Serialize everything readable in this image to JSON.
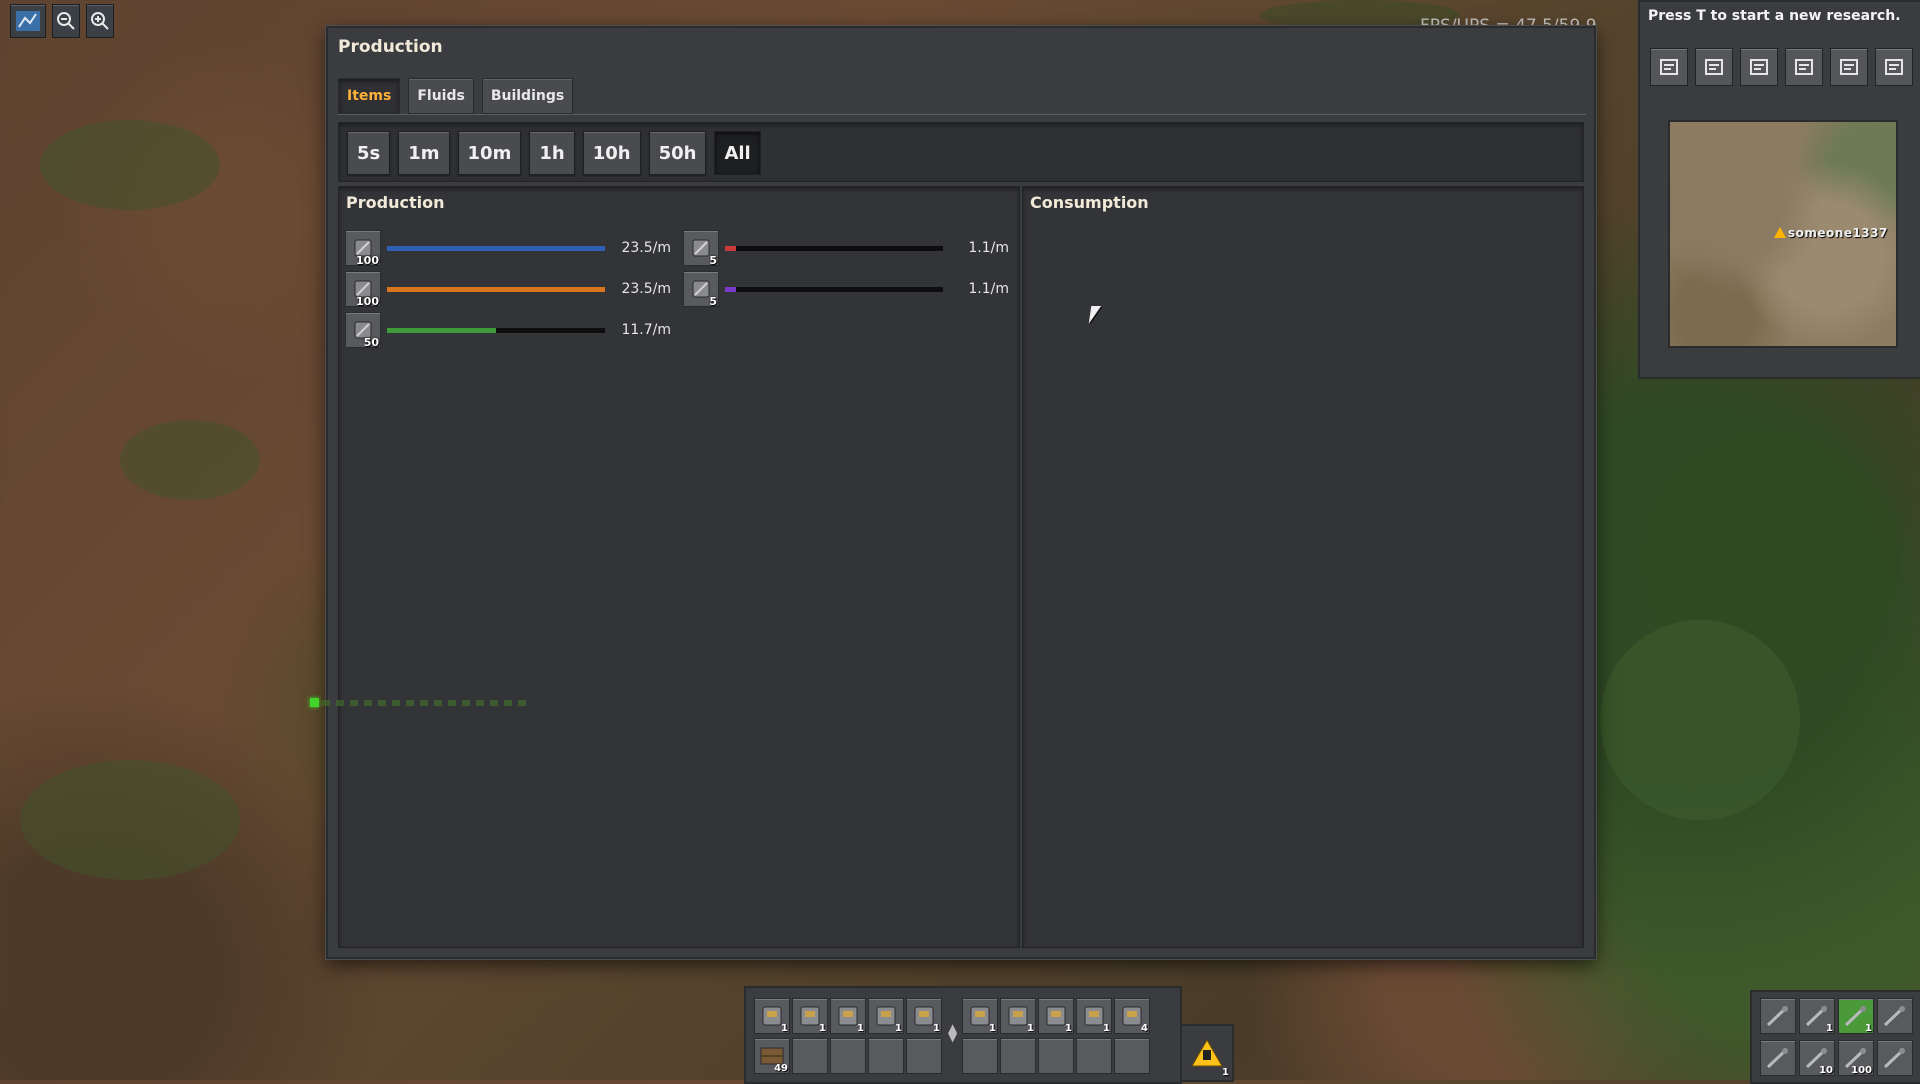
{
  "hud": {
    "fps_text": "FPS/UPS = 47.5/59.9"
  },
  "window": {
    "title": "Production",
    "tabs": [
      {
        "label": "Items",
        "active": true
      },
      {
        "label": "Fluids",
        "active": false
      },
      {
        "label": "Buildings",
        "active": false
      }
    ],
    "time_ranges": [
      {
        "label": "5s",
        "selected": false
      },
      {
        "label": "1m",
        "selected": false
      },
      {
        "label": "10m",
        "selected": false
      },
      {
        "label": "1h",
        "selected": false
      },
      {
        "label": "10h",
        "selected": false
      },
      {
        "label": "50h",
        "selected": false
      },
      {
        "label": "All",
        "selected": true
      }
    ],
    "production_panel": {
      "title": "Production",
      "rows": [
        {
          "icon": "repair-pack-icon",
          "count": "100",
          "bar_color": "#2f5fb3",
          "fill": 1.0,
          "rate": "23.5/m"
        },
        {
          "icon": "firearm-magazine-icon",
          "count": "100",
          "bar_color": "#d9741f",
          "fill": 1.0,
          "rate": "23.5/m"
        },
        {
          "icon": "wooden-chest-icon",
          "count": "50",
          "bar_color": "#3f9a3a",
          "fill": 0.5,
          "rate": "11.7/m"
        },
        {
          "icon": "burner-drill-icon",
          "count": "5",
          "bar_color": "#c93b3b",
          "fill": 0.05,
          "rate": "1.1/m"
        },
        {
          "icon": "burner-inserter-icon",
          "count": "5",
          "bar_color": "#7a3ac9",
          "fill": 0.05,
          "rate": "1.1/m"
        }
      ]
    },
    "consumption_panel": {
      "title": "Consumption"
    }
  },
  "research": {
    "prompt": "Press T to start a new research.",
    "toolbar_icons": [
      "map-icon",
      "production-stats-icon",
      "bonus-icon",
      "research-icon",
      "train-icon",
      "achievements-icon"
    ],
    "minimap": {
      "player_name": "someone1337"
    }
  },
  "hotbar": {
    "row1": [
      {
        "icon": "pistol-icon",
        "count": "1"
      },
      {
        "icon": "burner-drill-icon",
        "count": "1"
      },
      {
        "icon": "gear-icon",
        "count": "1"
      },
      {
        "icon": "small-pole-icon",
        "count": "1"
      },
      {
        "icon": "furnace-icon",
        "count": "1"
      },
      {
        "icon": "assembler-icon",
        "count": "1"
      },
      {
        "icon": "inserter-icon",
        "count": "1"
      },
      {
        "icon": "lab-icon",
        "count": "1"
      },
      {
        "icon": "chest-pink-icon",
        "count": "1"
      },
      {
        "icon": "drill-icon",
        "count": "4"
      }
    ],
    "row2": [
      {
        "icon": "wooden-chest-icon",
        "count": "49"
      }
    ],
    "alert_count": "1"
  },
  "quickbar": {
    "slots": [
      {
        "icon": "pickaxe-icon",
        "count": ""
      },
      {
        "icon": "gun-icon",
        "count": "1"
      },
      {
        "icon": "shotgun-icon",
        "count": "1"
      },
      {
        "icon": "pistol-icon",
        "count": ""
      },
      {
        "icon": "armor-icon",
        "count": ""
      },
      {
        "icon": "ammo-icon",
        "count": "10"
      },
      {
        "icon": "magazine-icon",
        "count": "100"
      },
      {
        "icon": "sword-icon",
        "count": ""
      }
    ]
  }
}
